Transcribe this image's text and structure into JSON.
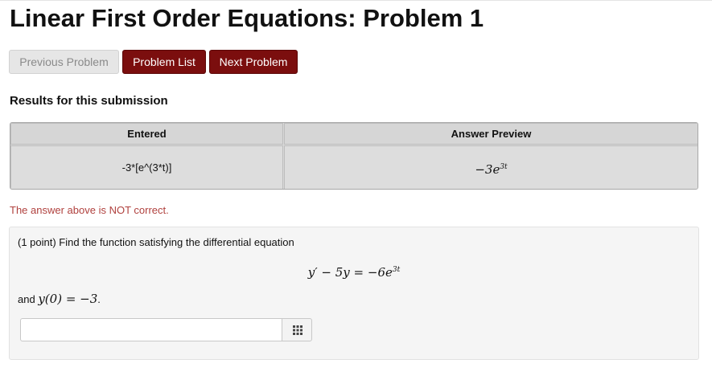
{
  "page": {
    "title": "Linear First Order Equations: Problem 1"
  },
  "nav": {
    "previous_label": "Previous Problem",
    "list_label": "Problem List",
    "next_label": "Next Problem"
  },
  "results": {
    "heading": "Results for this submission",
    "columns": [
      "Entered",
      "Answer Preview"
    ],
    "entered": "-3*[e^(3*t)]",
    "preview_base": "−3e",
    "preview_exp": "3t",
    "status_message": "The answer above is NOT correct."
  },
  "problem": {
    "statement": "(1 point) Find the function satisfying the differential equation",
    "equation_main": "y′ − 5y = −6e",
    "equation_exp": "3t",
    "condition_prefix": "and",
    "condition_math": "y(0) = −3",
    "condition_suffix": ".",
    "answer_value": "",
    "palette_icon": "grid-icon"
  },
  "colors": {
    "primary_button": "#7b0e0e",
    "error_text": "#b0413e",
    "disabled_button": "#e6e6e6"
  }
}
